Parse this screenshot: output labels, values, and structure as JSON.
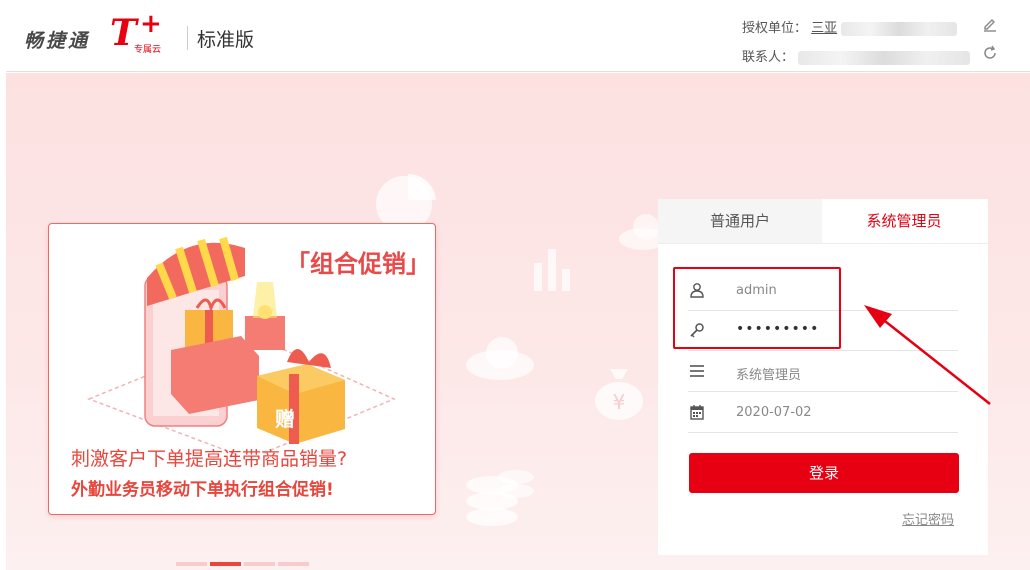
{
  "header": {
    "logo_text": "畅捷通",
    "logo_mark": "T",
    "logo_plus": "+",
    "logo_sub": "专属云",
    "edition": "标准版",
    "auth_unit_label": "授权单位：",
    "auth_unit_value": "三亚",
    "contact_label": "联系人："
  },
  "promo": {
    "title": "「组合促销」",
    "line1": "刺激客户下单提高连带商品销量?",
    "line2": "外勤业务员移动下单执行组合促销!",
    "gift_char": "赠"
  },
  "login": {
    "tabs": [
      {
        "label": "普通用户",
        "active": false
      },
      {
        "label": "系统管理员",
        "active": true
      }
    ],
    "username_value": "admin",
    "password_value": "•••••••••",
    "role_value": "系统管理员",
    "date_value": "2020-07-02",
    "login_button": "登录",
    "forgot_link": "忘记密码"
  },
  "colors": {
    "accent": "#e60012",
    "promo_text": "#e8463c"
  }
}
